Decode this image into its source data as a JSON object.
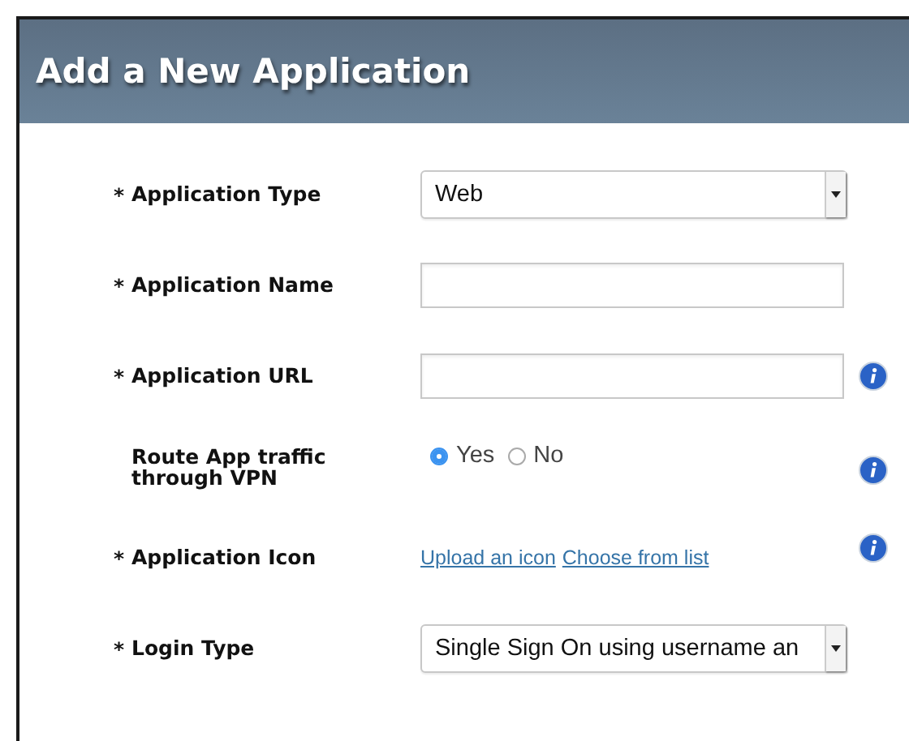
{
  "dialog": {
    "title": "Add a New Application"
  },
  "fields": [
    {
      "mark": "*",
      "label": "Application Type",
      "kind": "select",
      "value": "Web",
      "info": false
    },
    {
      "mark": "*",
      "label": "Application Name",
      "kind": "text",
      "info": false
    },
    {
      "mark": "*",
      "label": "Application URL",
      "kind": "text",
      "info": true
    },
    {
      "label": "Route App traffic through VPN",
      "kind": "radio",
      "options": [
        {
          "label": "Yes",
          "selected": true
        },
        {
          "label": "No",
          "selected": false
        }
      ],
      "info": true
    },
    {
      "mark": "*",
      "label": "Application Icon",
      "kind": "links",
      "links": [
        "Upload an icon",
        "Choose from list"
      ],
      "info": true
    },
    {
      "mark": "*",
      "label": "Login Type",
      "kind": "select",
      "value": "Single Sign On using username an",
      "info": false
    }
  ]
}
